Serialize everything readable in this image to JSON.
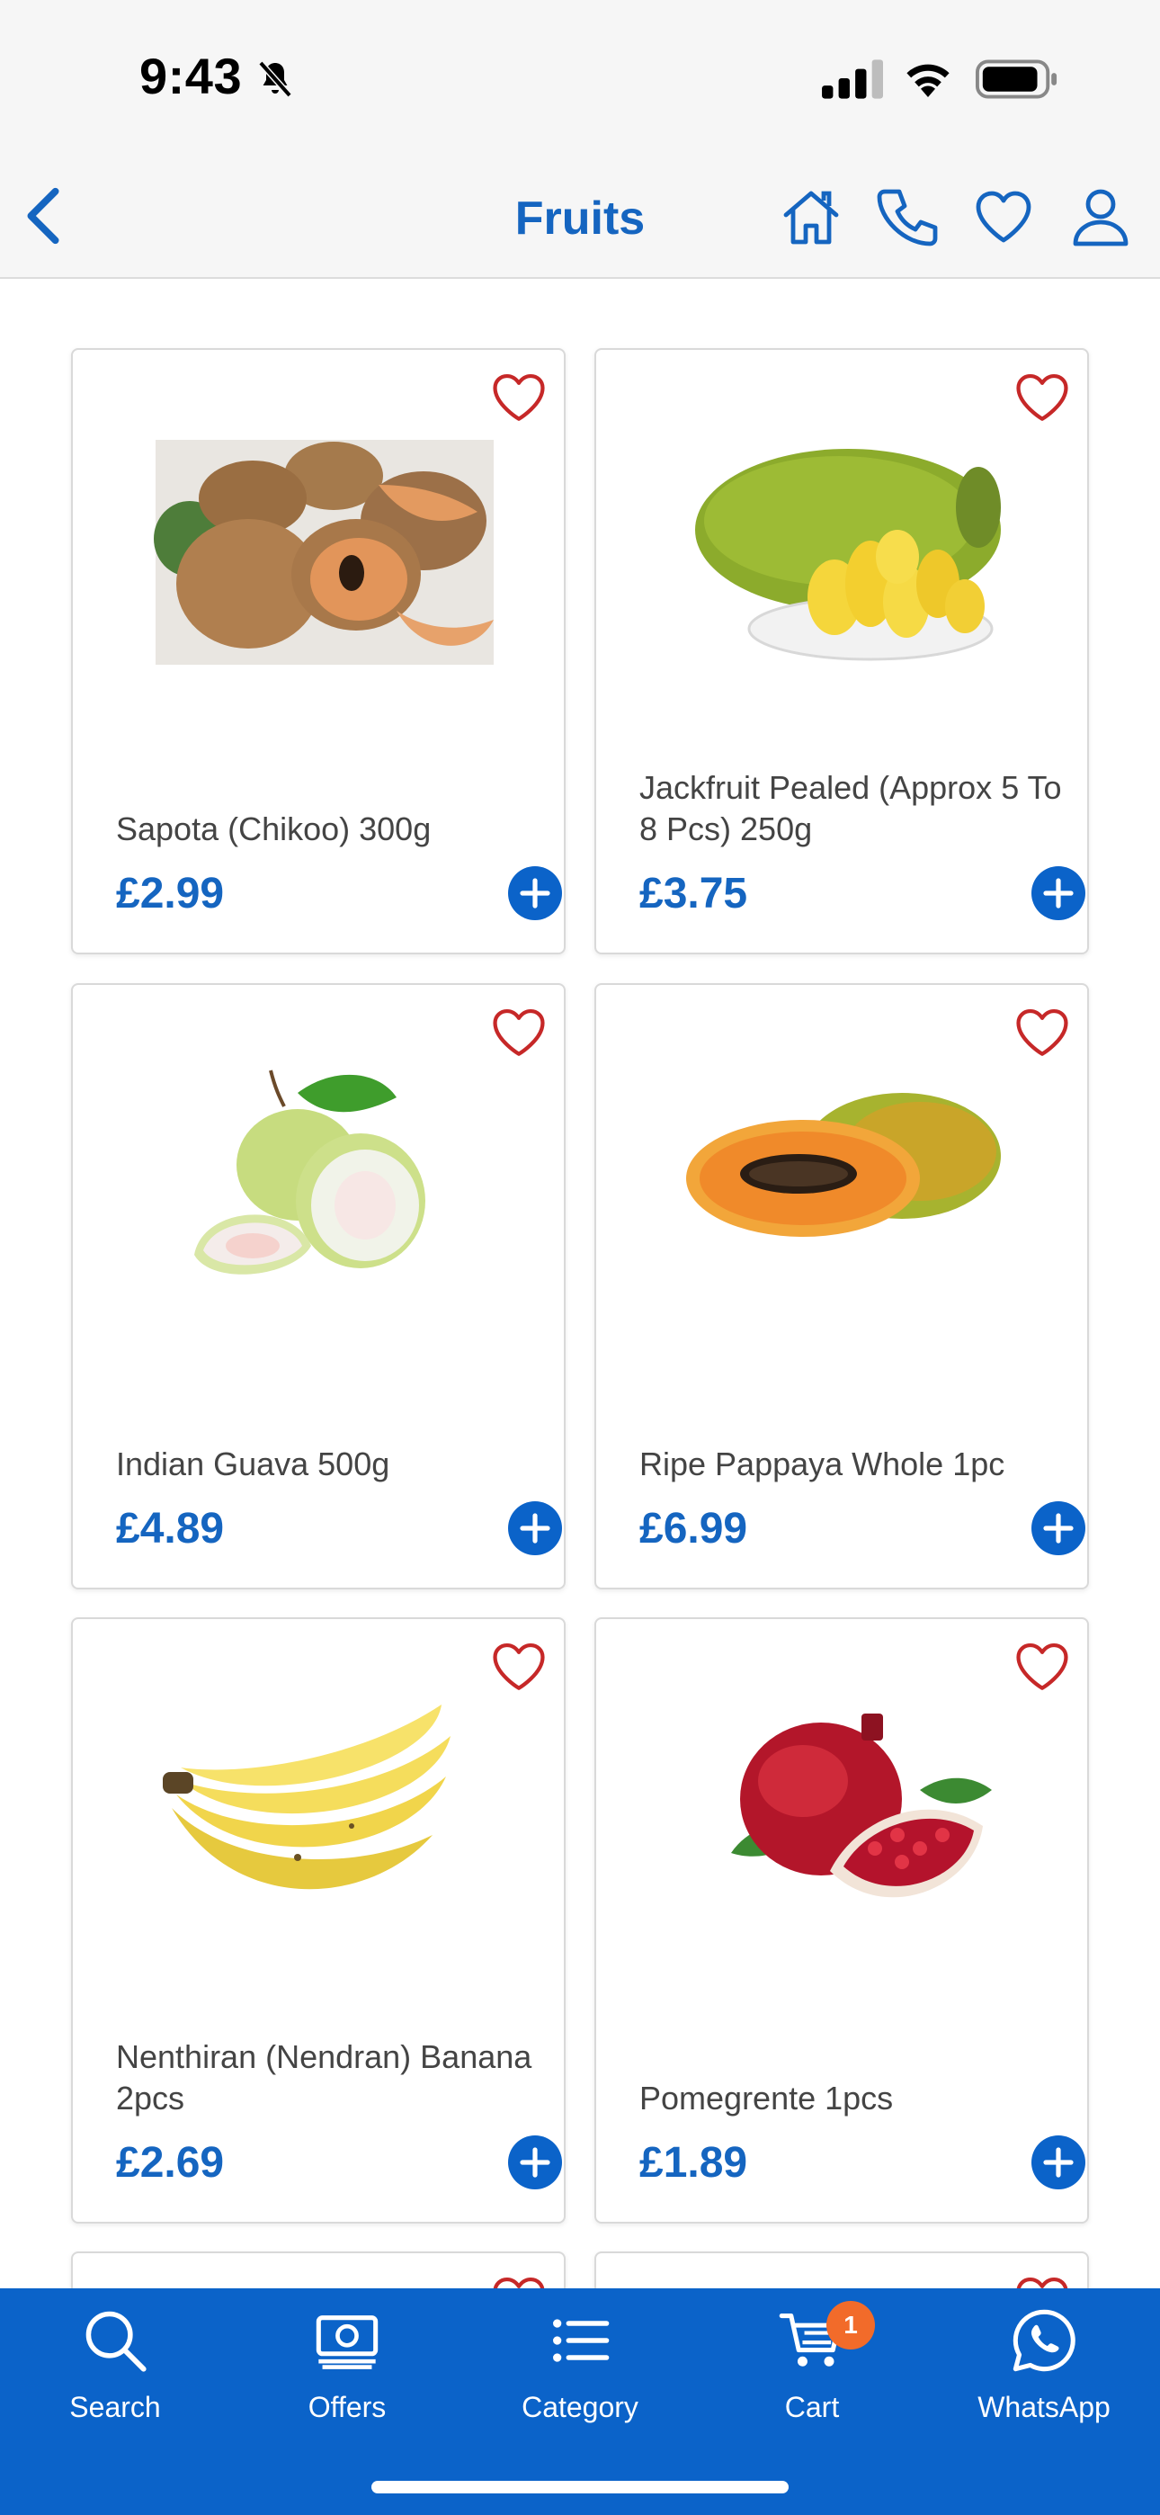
{
  "status_bar": {
    "time": "9:43"
  },
  "nav": {
    "title": "Fruits"
  },
  "colors": {
    "brand_blue": "#1565c0",
    "tab_bar": "#0b63c9",
    "heart_red": "#c62828",
    "badge": "#f26b2a"
  },
  "products": [
    {
      "name": "Sapota (Chikoo) 300g",
      "price": "£2.99",
      "image": "sapota"
    },
    {
      "name": "Jackfruit Pealed (Approx 5 To 8 Pcs) 250g",
      "price": "£3.75",
      "image": "jackfruit"
    },
    {
      "name": "Indian Guava 500g",
      "price": "£4.89",
      "image": "guava"
    },
    {
      "name": "Ripe Pappaya Whole 1pc",
      "price": "£6.99",
      "image": "papaya"
    },
    {
      "name": "Nenthiran (Nendran) Banana 2pcs",
      "price": "£2.69",
      "image": "banana"
    },
    {
      "name": "Pomegrente 1pcs",
      "price": "£1.89",
      "image": "pomegranate"
    }
  ],
  "tabs": [
    {
      "label": "Search",
      "icon": "search-icon"
    },
    {
      "label": "Offers",
      "icon": "offers-icon"
    },
    {
      "label": "Category",
      "icon": "list-icon"
    },
    {
      "label": "Cart",
      "icon": "cart-icon",
      "badge": "1"
    },
    {
      "label": "WhatsApp",
      "icon": "whatsapp-icon"
    }
  ]
}
